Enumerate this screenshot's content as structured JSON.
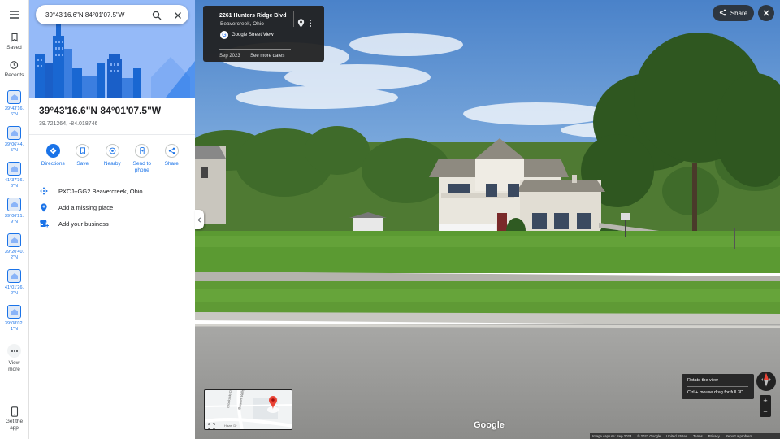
{
  "rail": {
    "saved_label": "Saved",
    "recents_label": "Recents",
    "recent_items": [
      {
        "label": "39°43'16.6\"N"
      },
      {
        "label": "39°06'44.5\"N"
      },
      {
        "label": "41°37'36.6\"N"
      },
      {
        "label": "39°06'21.9\"N"
      },
      {
        "label": "39°20'40.2\"N"
      },
      {
        "label": "41°01'26.2\"N"
      },
      {
        "label": "39°08'02.1\"N"
      }
    ],
    "view_more_label": "View more",
    "get_app_label": "Get the app"
  },
  "search": {
    "value": "39°43'16.6\"N 84°01'07.5\"W"
  },
  "place": {
    "title": "39°43'16.6\"N 84°01'07.5\"W",
    "coords": "39.721264, -84.018746"
  },
  "actions": {
    "directions": "Directions",
    "save": "Save",
    "nearby": "Nearby",
    "send_to_phone": "Send to phone",
    "share": "Share"
  },
  "info_rows": {
    "plus_code": "PXCJ+GG2 Beavercreek, Ohio",
    "add_place": "Add a missing place",
    "add_business": "Add your business"
  },
  "street_view": {
    "street": "2261 Hunters Ridge Blvd",
    "locality": "Beavercreek, Ohio",
    "source": "Google Street View",
    "date": "Sep 2023",
    "see_more_dates": "See more dates",
    "share_label": "Share",
    "tooltip_title": "Rotate the view",
    "tooltip_hint": "Ctrl + mouse drag for full 3D",
    "zoom_in": "+",
    "zoom_out": "−",
    "google_logo": "Google"
  },
  "minimap": {
    "street_1": "Brookside Dr",
    "street_2": "Beaver Valley",
    "street_3": "Hazel Dr"
  },
  "footer": {
    "capture": "Image capture: Sep 2023",
    "copyright": "© 2023 Google",
    "region": "United States",
    "terms": "Terms",
    "privacy": "Privacy",
    "report": "Report a problem"
  },
  "colors": {
    "accent": "#1a73e8",
    "sky": "#4f86c6",
    "grass": "#6a9c3b",
    "road": "#9a9a98",
    "pin": "#ea4335"
  }
}
